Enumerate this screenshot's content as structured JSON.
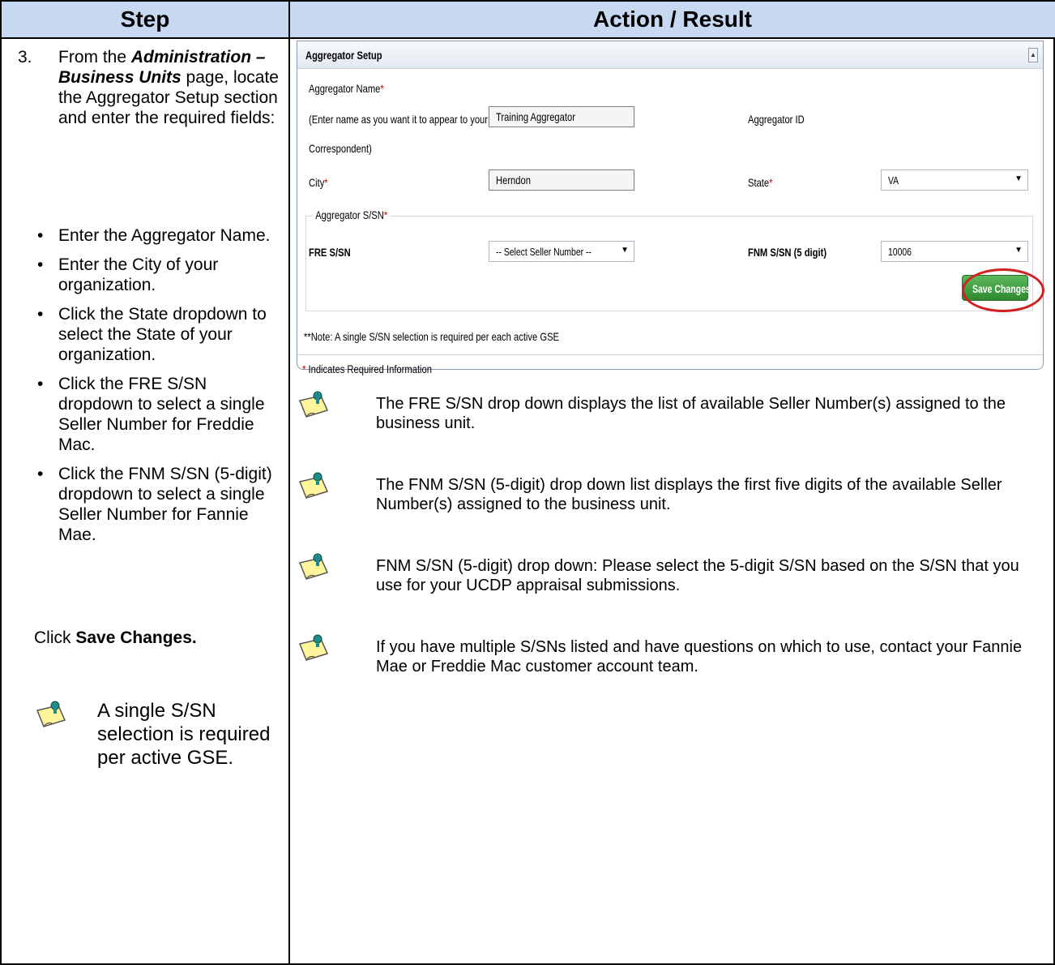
{
  "header": {
    "step": "Step",
    "action": "Action / Result"
  },
  "step": {
    "number": "3.",
    "intro_prefix": "From the ",
    "intro_bold_italic": "Administration – Business Units",
    "intro_suffix": " page, locate the Aggregator Setup section and enter the required fields:",
    "bullets": [
      "Enter the Aggregator Name.",
      "Enter the City of your organization.",
      "Click the State dropdown to select the State of your organization.",
      "Click the FRE S/SN dropdown to select a single Seller Number for Freddie Mac.",
      "Click the FNM S/SN (5-digit) dropdown to select a single Seller Number for Fannie Mae."
    ],
    "click_prefix": "Click ",
    "click_bold": "Save Changes.",
    "note": "A single S/SN selection is required per active GSE."
  },
  "panel": {
    "title": "Aggregator Setup",
    "aggregator_name_label": "Aggregator Name",
    "aggregator_name_hint_1": "(Enter name as you want it to appear to your",
    "aggregator_name_hint_2": "Correspondent)",
    "aggregator_name_value": "Training Aggregator",
    "aggregator_id_label": "Aggregator ID",
    "city_label": "City",
    "city_value": "Herndon",
    "state_label": "State",
    "state_value": "VA",
    "ssn_legend": "Aggregator S/SN",
    "fre_label": "FRE S/SN",
    "fre_value": "-- Select Seller Number --",
    "fnm_label": "FNM S/SN (5 digit)",
    "fnm_value": "10006",
    "save_label": "Save Changes",
    "note": "**Note: A single S/SN selection is required per each active GSE",
    "required_note": "Indicates Required Information",
    "asterisk": "*"
  },
  "notes": [
    "The FRE S/SN drop down displays the list of available Seller Number(s) assigned to the business unit.",
    "The FNM S/SN (5-digit) drop down list displays the first five digits of the available Seller Number(s) assigned to the business unit.",
    "FNM S/SN (5-digit) drop down: Please select the 5-digit S/SN based on the S/SN that you use for your UCDP appraisal submissions.",
    "If you have multiple S/SNs listed and have questions on which to use, contact your Fannie Mae or Freddie Mac customer account team."
  ],
  "colors": {
    "header_bg": "#c6d9f1",
    "save_green": "#3c9a3c",
    "highlight_red": "#d21f1f"
  }
}
